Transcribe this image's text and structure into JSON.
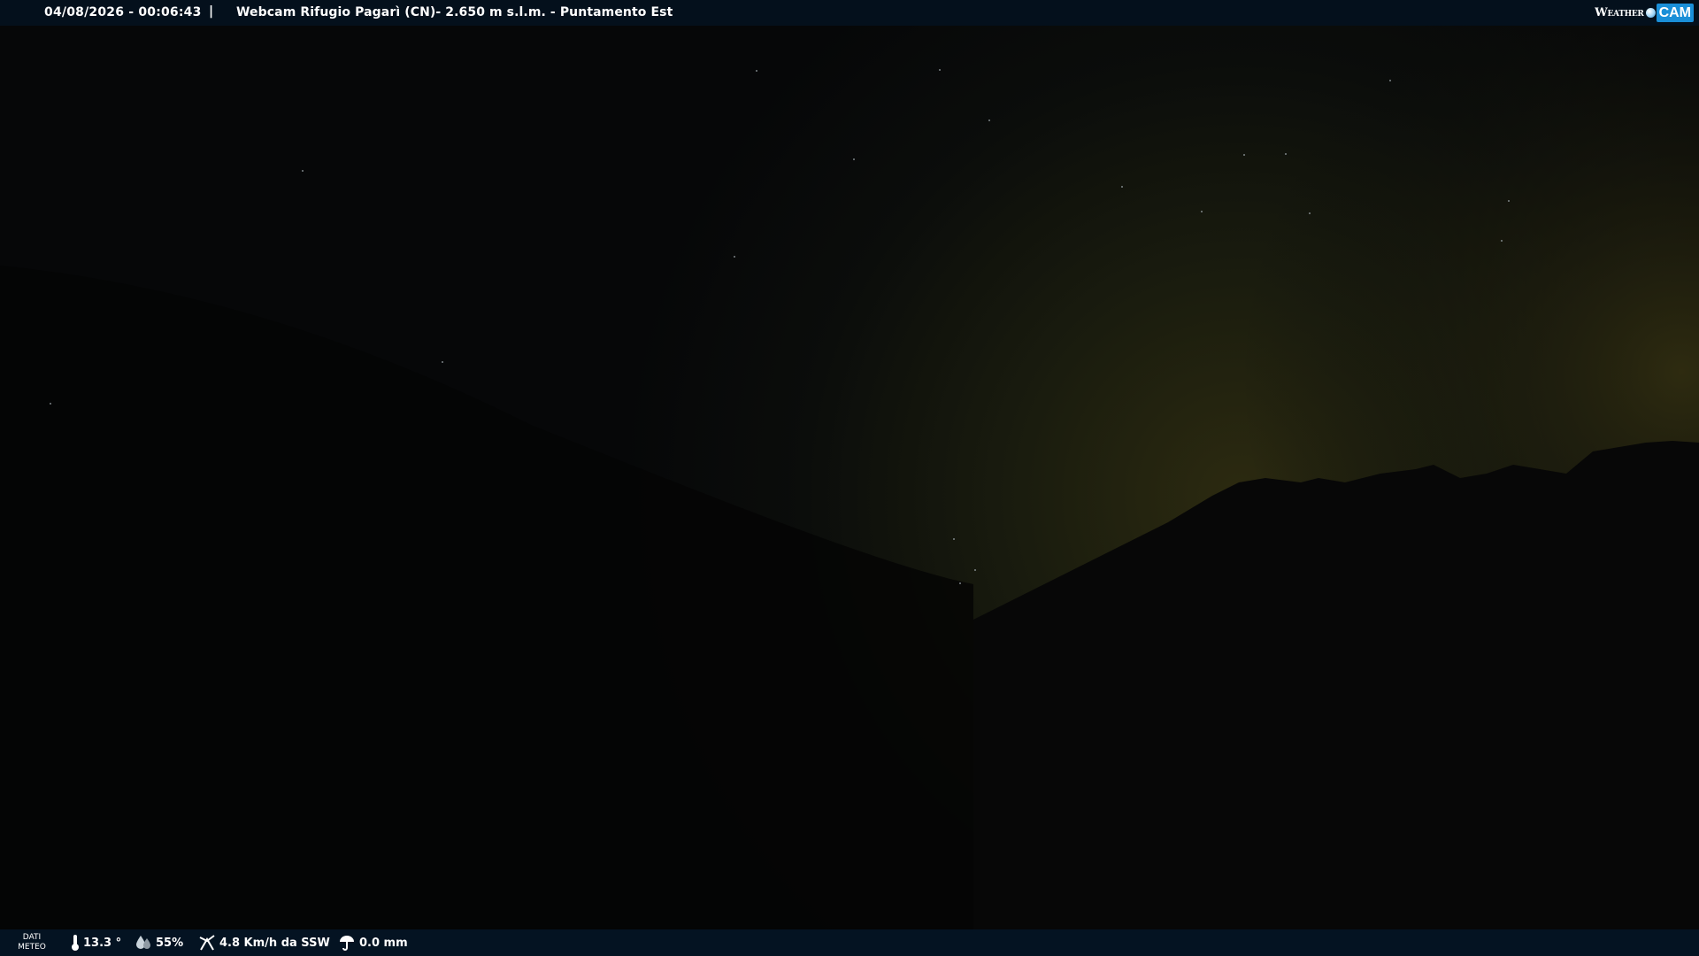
{
  "overlay": {
    "datetime": "04/08/2026 - 00:06:43",
    "separator": "|",
    "title": "Webcam Rifugio Pagarì (CN)- 2.650 m s.l.m. - Puntamento Est",
    "logo": {
      "weather": "Weather",
      "cam": "CAM"
    }
  },
  "meteo": {
    "label_line1": "DATI",
    "label_line2": "METEO",
    "temperature": "13.3 °",
    "humidity": "55%",
    "wind": "4.8 Km/h da SSW",
    "rain": "0.0 mm",
    "icons": [
      "thermometer-icon",
      "humidity-icon",
      "wind-icon",
      "rain-icon"
    ]
  },
  "colors": {
    "bar_background": "#04101c",
    "logo_accent": "#1a8fd8"
  }
}
